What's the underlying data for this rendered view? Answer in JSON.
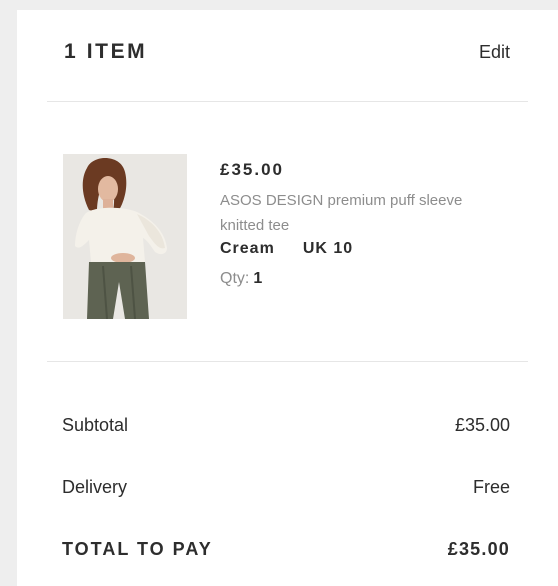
{
  "bag": {
    "item_count_label": "1 ITEM",
    "edit_label": "Edit"
  },
  "item": {
    "price": "£35.00",
    "name": "ASOS DESIGN premium puff sleeve knitted tee",
    "colour": "Cream",
    "size": "UK 10",
    "qty_label": "Qty:",
    "qty_value": "1",
    "image_icon": "product-photo"
  },
  "totals": {
    "subtotal_label": "Subtotal",
    "subtotal_value": "£35.00",
    "delivery_label": "Delivery",
    "delivery_value": "Free",
    "total_label": "TOTAL TO PAY",
    "total_value": "£35.00"
  },
  "colors": {
    "text": "#2d2d2d",
    "muted": "#8d8d8d",
    "divider": "#e6e6e6",
    "page_bg": "#eeeeee",
    "card_bg": "#ffffff"
  }
}
